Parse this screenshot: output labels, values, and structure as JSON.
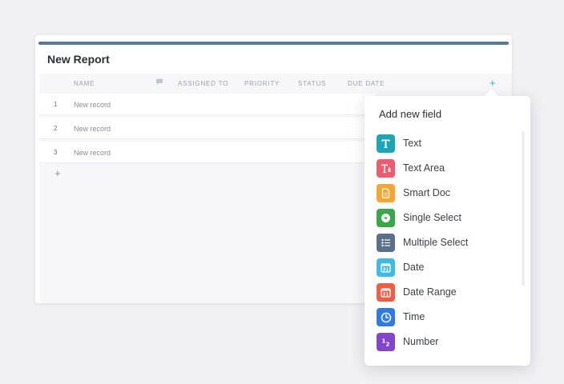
{
  "report": {
    "title": "New Report"
  },
  "table": {
    "columns": {
      "name": "NAME",
      "assigned_to": "ASSIGNED TO",
      "priority": "PRIORITY",
      "status": "STATUS",
      "due_date": "DUE DATE",
      "add": "+"
    },
    "rows": [
      {
        "num": "1",
        "name": "New record"
      },
      {
        "num": "2",
        "name": "New record"
      },
      {
        "num": "3",
        "name": "New record"
      }
    ],
    "add_row": "+"
  },
  "field_menu": {
    "title": "Add new field",
    "items": [
      {
        "label": "Text",
        "icon": "text-icon",
        "color": "#1aa6b7"
      },
      {
        "label": "Text Area",
        "icon": "text-area-icon",
        "color": "#ef5b6e"
      },
      {
        "label": "Smart Doc",
        "icon": "smart-doc-icon",
        "color": "#f7a531"
      },
      {
        "label": "Single Select",
        "icon": "single-select-icon",
        "color": "#3aa64a"
      },
      {
        "label": "Multiple Select",
        "icon": "multiple-select-icon",
        "color": "#5a6f89"
      },
      {
        "label": "Date",
        "icon": "date-icon",
        "color": "#3fb9e6"
      },
      {
        "label": "Date Range",
        "icon": "date-range-icon",
        "color": "#ee5e46"
      },
      {
        "label": "Time",
        "icon": "time-icon",
        "color": "#2f7be6"
      },
      {
        "label": "Number",
        "icon": "number-icon",
        "color": "#8445c9"
      }
    ]
  }
}
